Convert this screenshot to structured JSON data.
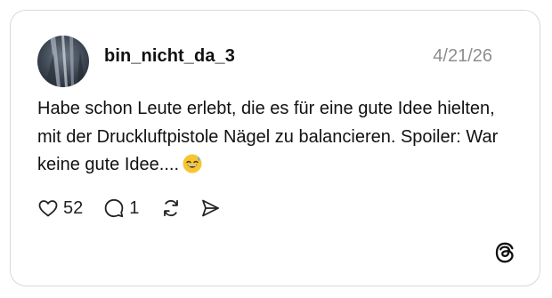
{
  "post": {
    "username": "bin_nicht_da_3",
    "date": "4/21/26",
    "text": "Habe schon Leute erlebt, die es für eine gute Idee hielten, mit der Druckluftpistole Nägel zu balancieren. Spoiler: War keine gute Idee....",
    "emoji": "grinning-face-with-sweat"
  },
  "actions": {
    "like_icon": "heart-icon",
    "like_count": "52",
    "reply_icon": "comment-icon",
    "reply_count": "1",
    "repost_icon": "repost-icon",
    "share_icon": "send-icon"
  },
  "brand": {
    "logo": "threads-logo-icon"
  },
  "colors": {
    "text": "#111111",
    "muted": "#8e8e8e",
    "border": "#d9d9d9",
    "emoji": "#f7c531"
  }
}
